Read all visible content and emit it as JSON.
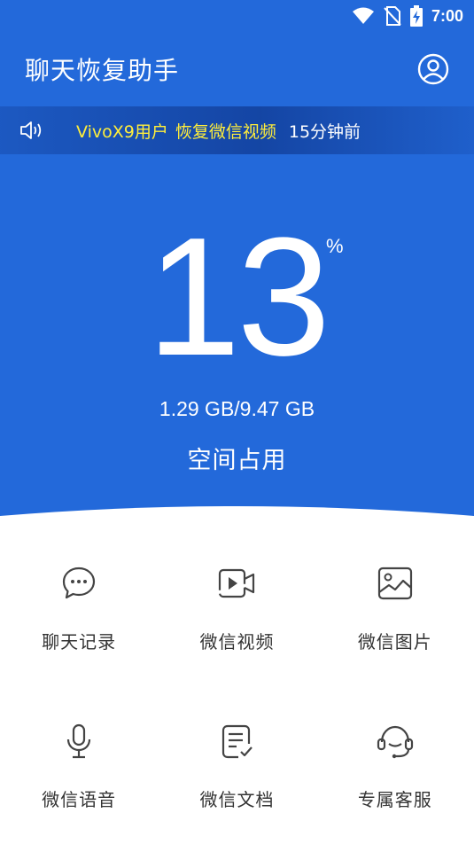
{
  "status_bar": {
    "time": "7:00",
    "icons": [
      "wifi-icon",
      "no-sim-icon",
      "battery-charging-icon"
    ]
  },
  "app": {
    "title": "聊天恢复助手",
    "profile_icon": "user-circle-icon"
  },
  "ticker": {
    "icon": "speaker-icon",
    "user": "VivoX9用户",
    "action": "恢复微信视频",
    "time": "15分钟前"
  },
  "usage": {
    "percent": "13",
    "percent_sign": "%",
    "storage": "1.29 GB/9.47 GB",
    "label": "空间占用"
  },
  "features": [
    {
      "label": "聊天记录",
      "icon": "chat-bubble-icon"
    },
    {
      "label": "微信视频",
      "icon": "video-icon"
    },
    {
      "label": "微信图片",
      "icon": "image-icon"
    },
    {
      "label": "微信语音",
      "icon": "microphone-icon"
    },
    {
      "label": "微信文档",
      "icon": "document-icon"
    },
    {
      "label": "专属客服",
      "icon": "headset-icon"
    }
  ],
  "colors": {
    "primary": "#2369da",
    "ticker_highlight": "#ffee3b",
    "icon_gray": "#444444",
    "label_text": "#333333"
  }
}
